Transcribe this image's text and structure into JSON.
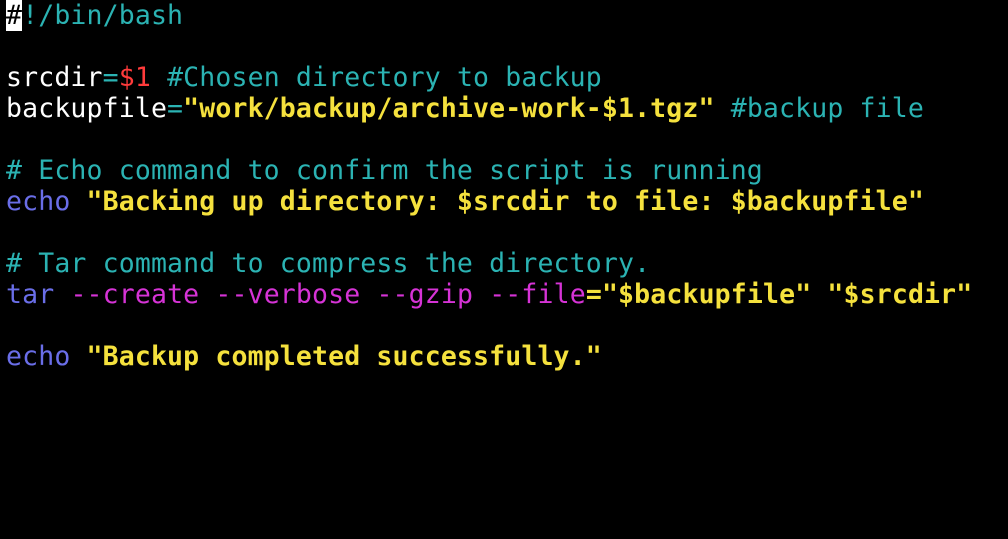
{
  "colors": {
    "background": "#000000",
    "comment": "#2bb3b3",
    "variable": "#ffffff",
    "operator": "#2bb3b3",
    "positional_param": "#ff3b3b",
    "string": "#f5e13d",
    "command": "#6a6ee8",
    "flag": "#d633d6",
    "cursor": "#ffffff"
  },
  "script": {
    "shebang": {
      "cursor_char": "#",
      "rest": "!/bin/bash"
    },
    "assign_srcdir": {
      "name": "srcdir",
      "eq": "=",
      "value": "$1",
      "comment": "#Chosen directory to backup"
    },
    "assign_backupfile": {
      "name": "backupfile",
      "eq": "=",
      "value": "\"work/backup/archive-work-$1.tgz\"",
      "comment": "#backup file"
    },
    "comment_echo": "# Echo command to confirm the script is running",
    "echo1": {
      "command": "echo",
      "arg": "\"Backing up directory: $srcdir to file: $backupfile\""
    },
    "comment_tar": "# Tar command to compress the directory.",
    "tar": {
      "command": "tar",
      "flag1": "--create",
      "flag2": "--verbose",
      "flag3": "--gzip",
      "flag4": "--file",
      "eq": "=",
      "arg1": "\"$backupfile\"",
      "arg2": "\"$srcdir\""
    },
    "echo2": {
      "command": "echo",
      "arg": "\"Backup completed successfully.\""
    }
  }
}
